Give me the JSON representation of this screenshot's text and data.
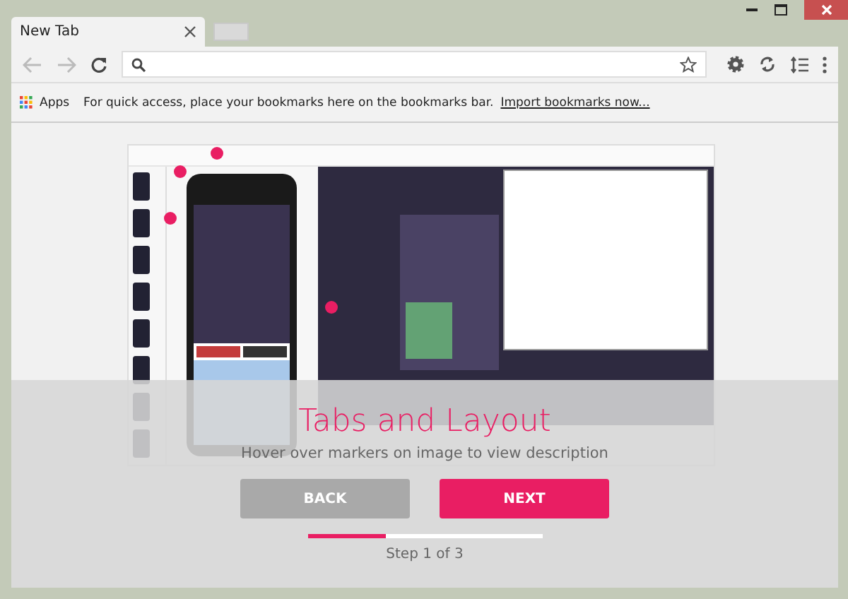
{
  "tabs": [
    {
      "label": "New Tab",
      "selected": true
    }
  ],
  "bookmarks_bar": {
    "apps_label": "Apps",
    "message": "For quick access, place your bookmarks here on the bookmarks bar.",
    "link": "Import bookmarks now..."
  },
  "tour": {
    "title": "Tabs and Layout",
    "subtitle": "Hover over markers on image to view description",
    "buttons": [
      {
        "label": "BACK",
        "disabled": true
      },
      {
        "label": "NEXT",
        "disabled": false
      }
    ],
    "progress": {
      "level": 0.333
    },
    "step": "Step 1 of 3"
  }
}
